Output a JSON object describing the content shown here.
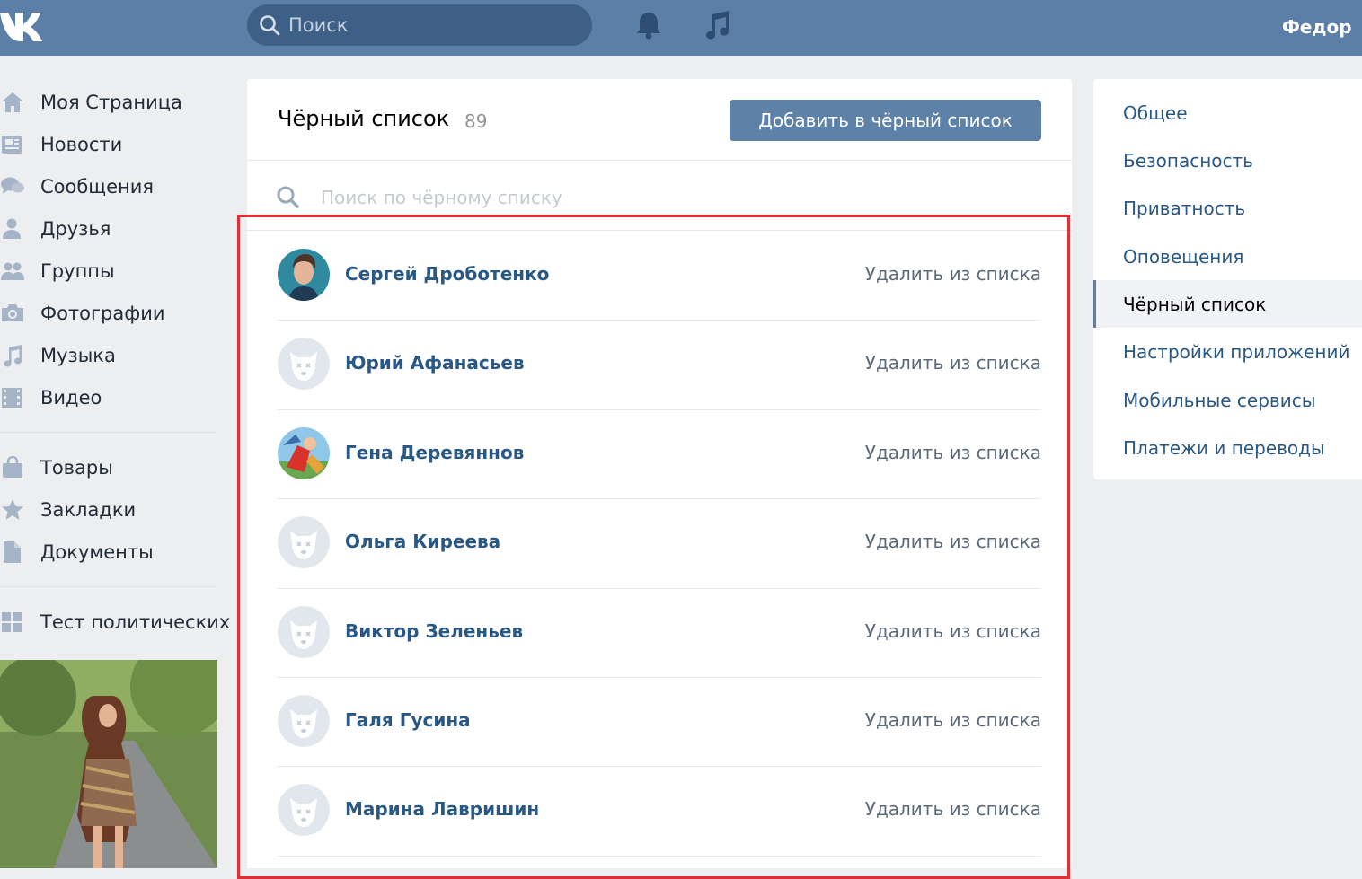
{
  "header": {
    "search_placeholder": "Поиск",
    "user_name": "Федор",
    "icons": [
      "vk-logo-icon",
      "search-icon",
      "bell-icon",
      "music-note-icon"
    ]
  },
  "left_nav": {
    "items": [
      {
        "label": "Моя Страница",
        "icon": "home-icon"
      },
      {
        "label": "Новости",
        "icon": "news-icon"
      },
      {
        "label": "Сообщения",
        "icon": "messages-icon"
      },
      {
        "label": "Друзья",
        "icon": "friends-icon"
      },
      {
        "label": "Группы",
        "icon": "groups-icon"
      },
      {
        "label": "Фотографии",
        "icon": "camera-icon"
      },
      {
        "label": "Музыка",
        "icon": "music-icon"
      },
      {
        "label": "Видео",
        "icon": "video-icon"
      }
    ],
    "items2": [
      {
        "label": "Товары",
        "icon": "bag-icon"
      },
      {
        "label": "Закладки",
        "icon": "star-icon"
      },
      {
        "label": "Документы",
        "icon": "document-icon"
      }
    ],
    "items3": [
      {
        "label": "Тест политических",
        "icon": "apps-grid-icon"
      }
    ]
  },
  "blacklist": {
    "title": "Чёрный список",
    "count": "89",
    "add_button": "Добавить в чёрный список",
    "search_placeholder": "Поиск по чёрному списку",
    "remove_label": "Удалить из списка",
    "rows": [
      {
        "name": "Сергей Дроботенко",
        "avatar": "photo"
      },
      {
        "name": "Юрий Афанасьев",
        "avatar": "default"
      },
      {
        "name": "Гена Деревяннов",
        "avatar": "photo2"
      },
      {
        "name": "Ольга Киреева",
        "avatar": "default"
      },
      {
        "name": "Виктор Зеленьев",
        "avatar": "default"
      },
      {
        "name": "Галя Гусина",
        "avatar": "default"
      },
      {
        "name": "Марина Лавришин",
        "avatar": "default"
      }
    ]
  },
  "settings_menu": {
    "items": [
      {
        "label": "Общее",
        "active": false
      },
      {
        "label": "Безопасность",
        "active": false
      },
      {
        "label": "Приватность",
        "active": false
      },
      {
        "label": "Оповещения",
        "active": false
      },
      {
        "label": "Чёрный список",
        "active": true
      },
      {
        "label": "Настройки приложений",
        "active": false
      },
      {
        "label": "Мобильные сервисы",
        "active": false
      },
      {
        "label": "Платежи и переводы",
        "active": false
      }
    ]
  },
  "colors": {
    "header": "#5b7fa6",
    "link": "#2a5885",
    "highlight": "#e02f37"
  }
}
